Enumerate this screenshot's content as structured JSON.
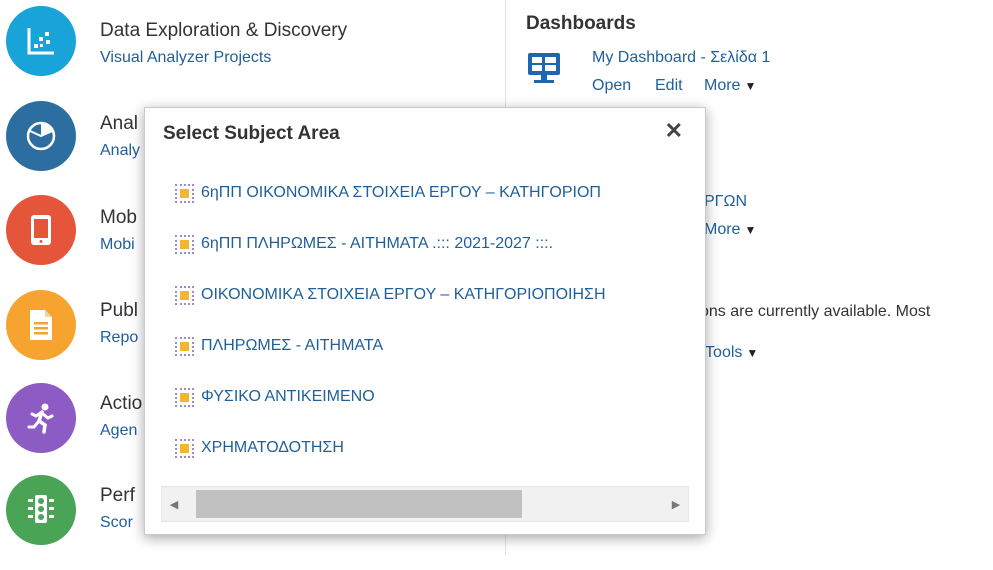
{
  "tasks": [
    {
      "title": "Data Exploration & Discovery",
      "link": "Visual Analyzer Projects",
      "color": "#18a3d9",
      "icon": "scatter-chart-icon"
    },
    {
      "title": "Anal",
      "link": "Analy",
      "color": "#2c6e9f",
      "icon": "pie-chart-icon"
    },
    {
      "title": "Mob",
      "link": "Mobi",
      "color": "#e5553a",
      "icon": "mobile-device-icon"
    },
    {
      "title": "Publ",
      "link": "Repo",
      "color": "#f7a330",
      "icon": "document-icon"
    },
    {
      "title": "Actio",
      "link": "Agen",
      "color": "#8c5bc4",
      "icon": "running-person-icon"
    },
    {
      "title": "Perf",
      "link": "Scor",
      "color": "#4aa455",
      "icon": "traffic-light-icon"
    }
  ],
  "dashboards": {
    "heading": "Dashboards",
    "item_title": "My Dashboard - Σελίδα 1",
    "open": "Open",
    "edit": "Edit",
    "more": "More",
    "item2_title_partial": "ΡΓΩΝ",
    "item2_more": "More"
  },
  "info": {
    "text_partial": "tions are currently available. Most",
    "tools_partial": "p Tools"
  },
  "dialog": {
    "title": "Select Subject Area",
    "close": "✕",
    "items": [
      "6ηΠΠ ΟΙΚΟΝΟΜΙΚΑ ΣΤΟΙΧΕΙΑ ΕΡΓΟΥ – ΚΑΤΗΓΟΡΙΟΠ",
      "6ηΠΠ ΠΛΗΡΩΜΕΣ - ΑΙΤΗΜΑΤΑ .::: 2021-2027 :::.",
      "ΟΙΚΟΝΟΜΙΚΑ ΣΤΟΙΧΕΙΑ ΕΡΓΟΥ – ΚΑΤΗΓΟΡΙΟΠΟΙΗΣΗ",
      "ΠΛΗΡΩΜΕΣ - ΑΙΤΗΜΑΤΑ",
      "ΦΥΣΙΚΟ ΑΝΤΙΚΕΙΜΕΝΟ",
      "ΧΡΗΜΑΤΟΔΟΤΗΣΗ"
    ]
  }
}
